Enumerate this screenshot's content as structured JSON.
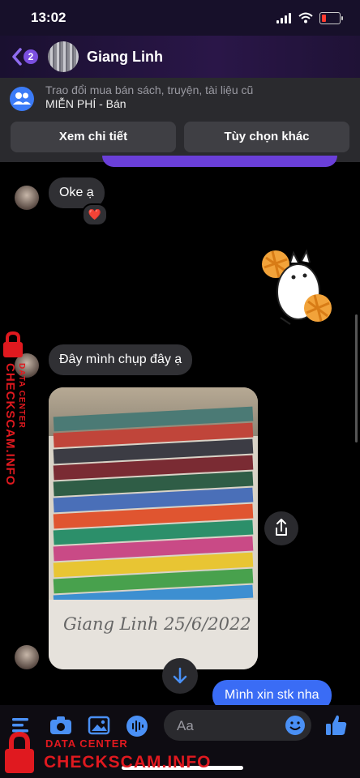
{
  "status_bar": {
    "time": "13:02"
  },
  "header": {
    "back_badge": "2",
    "contact_name": "Giang Linh"
  },
  "marketplace": {
    "title": "Trao đổi mua bán sách, truyện, tài liệu cũ",
    "subtitle": "MIỄN PHÍ - Bán",
    "detail_button": "Xem chi tiết",
    "options_button": "Tùy chọn khác"
  },
  "messages": [
    {
      "sender": "them",
      "text": "Oke ạ",
      "reaction": "❤️"
    },
    {
      "sender": "them",
      "text": "Đây mình chụp đây ạ"
    },
    {
      "sender": "them",
      "type": "photo",
      "handwriting": "Giang Linh 25/6/2022"
    },
    {
      "sender": "me",
      "text": "Mình xin stk nha"
    }
  ],
  "composer": {
    "placeholder": "Aa"
  },
  "watermark": {
    "label": "DATA CENTER",
    "site": "CHECKSCAM.INFO",
    "color": "#e0191f"
  },
  "colors": {
    "accent": "#3a6cf5",
    "header": "#2a1648",
    "badge": "#7b4fe0"
  }
}
